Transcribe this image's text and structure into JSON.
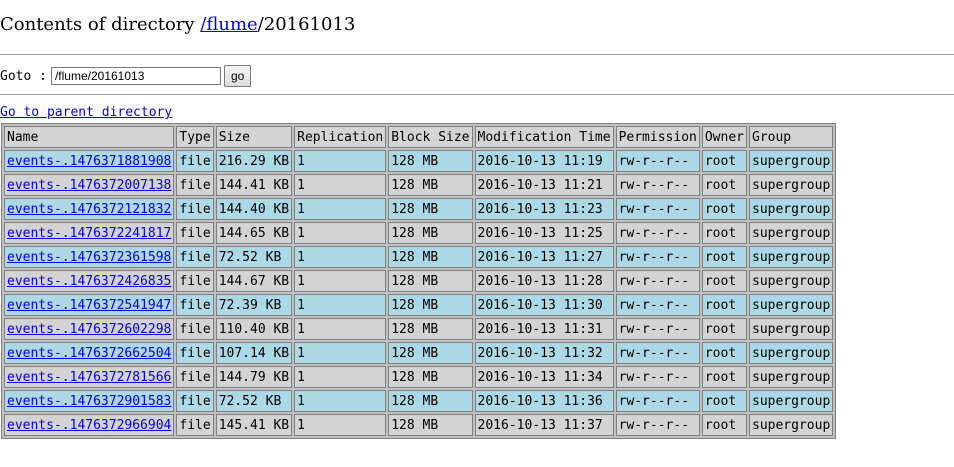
{
  "header": {
    "prefix": "Contents of directory ",
    "root_link": "/flume",
    "current": "/20161013"
  },
  "goto": {
    "label": "Goto : ",
    "value": "/flume/20161013",
    "button": "go"
  },
  "parent_link": "Go to parent directory",
  "table": {
    "columns": [
      "Name",
      "Type",
      "Size",
      "Replication",
      "Block Size",
      "Modification Time",
      "Permission",
      "Owner",
      "Group"
    ],
    "rows": [
      [
        "events-.1476371881908",
        "file",
        "216.29 KB",
        "1",
        "128 MB",
        "2016-10-13 11:19",
        "rw-r--r--",
        "root",
        "supergroup"
      ],
      [
        "events-.1476372007138",
        "file",
        "144.41 KB",
        "1",
        "128 MB",
        "2016-10-13 11:21",
        "rw-r--r--",
        "root",
        "supergroup"
      ],
      [
        "events-.1476372121832",
        "file",
        "144.40 KB",
        "1",
        "128 MB",
        "2016-10-13 11:23",
        "rw-r--r--",
        "root",
        "supergroup"
      ],
      [
        "events-.1476372241817",
        "file",
        "144.65 KB",
        "1",
        "128 MB",
        "2016-10-13 11:25",
        "rw-r--r--",
        "root",
        "supergroup"
      ],
      [
        "events-.1476372361598",
        "file",
        "72.52 KB",
        "1",
        "128 MB",
        "2016-10-13 11:27",
        "rw-r--r--",
        "root",
        "supergroup"
      ],
      [
        "events-.1476372426835",
        "file",
        "144.67 KB",
        "1",
        "128 MB",
        "2016-10-13 11:28",
        "rw-r--r--",
        "root",
        "supergroup"
      ],
      [
        "events-.1476372541947",
        "file",
        "72.39 KB",
        "1",
        "128 MB",
        "2016-10-13 11:30",
        "rw-r--r--",
        "root",
        "supergroup"
      ],
      [
        "events-.1476372602298",
        "file",
        "110.40 KB",
        "1",
        "128 MB",
        "2016-10-13 11:31",
        "rw-r--r--",
        "root",
        "supergroup"
      ],
      [
        "events-.1476372662504",
        "file",
        "107.14 KB",
        "1",
        "128 MB",
        "2016-10-13 11:32",
        "rw-r--r--",
        "root",
        "supergroup"
      ],
      [
        "events-.1476372781566",
        "file",
        "144.79 KB",
        "1",
        "128 MB",
        "2016-10-13 11:34",
        "rw-r--r--",
        "root",
        "supergroup"
      ],
      [
        "events-.1476372901583",
        "file",
        "72.52 KB",
        "1",
        "128 MB",
        "2016-10-13 11:36",
        "rw-r--r--",
        "root",
        "supergroup"
      ],
      [
        "events-.1476372966904",
        "file",
        "145.41 KB",
        "1",
        "128 MB",
        "2016-10-13 11:37",
        "rw-r--r--",
        "root",
        "supergroup"
      ]
    ]
  },
  "colors": {
    "row_blue": "#add8e6",
    "row_gray": "#d3d3d3",
    "link": "#0000ee"
  }
}
